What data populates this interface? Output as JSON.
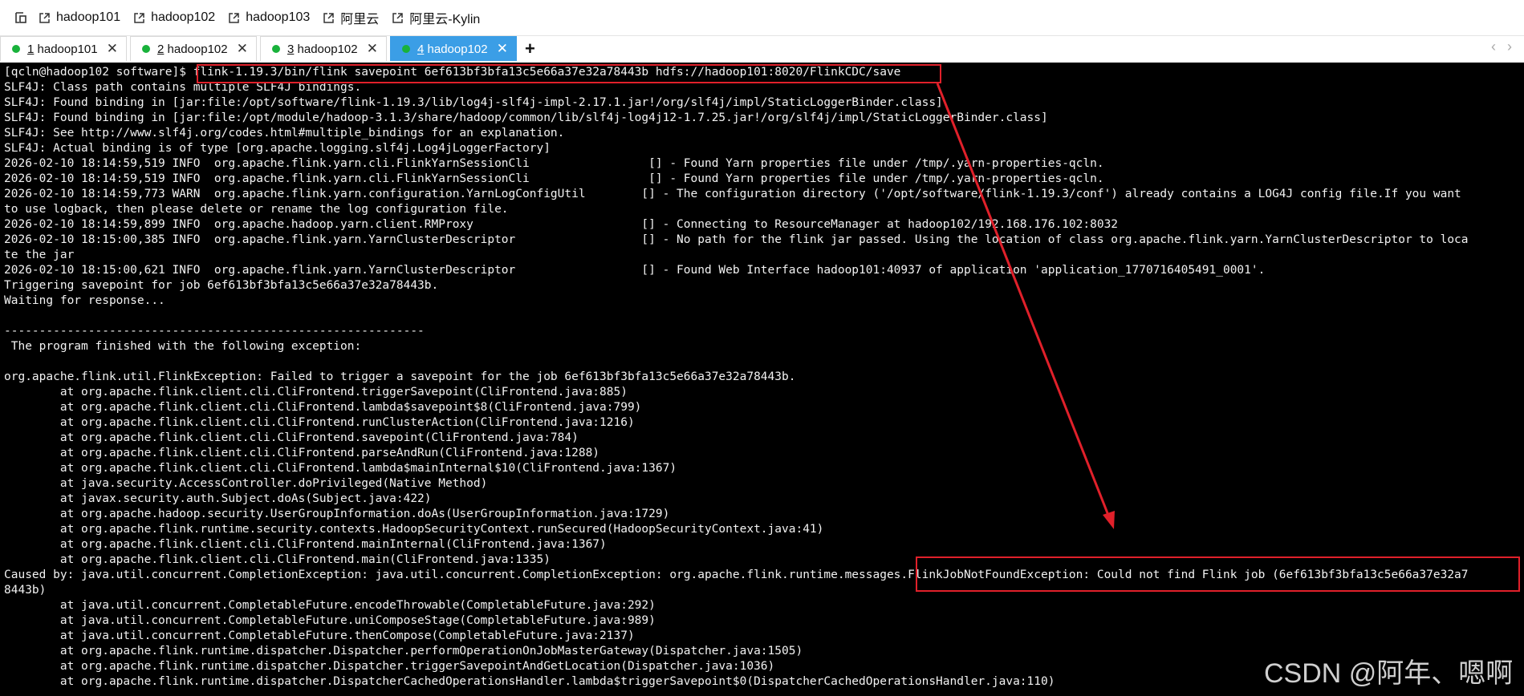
{
  "bookmarks": {
    "items": [
      "hadoop101",
      "hadoop102",
      "hadoop103",
      "阿里云",
      "阿里云-Kylin"
    ]
  },
  "tabs": [
    {
      "num": "1",
      "host": " hadoop101"
    },
    {
      "num": "2",
      "host": " hadoop102"
    },
    {
      "num": "3",
      "host": " hadoop102"
    },
    {
      "num": "4",
      "host": " hadoop102"
    }
  ],
  "terminal": {
    "lines": [
      "[qcln@hadoop102 software]$ flink-1.19.3/bin/flink savepoint 6ef613bf3bfa13c5e66a37e32a78443b hdfs://hadoop101:8020/FlinkCDC/save",
      "SLF4J: Class path contains multiple SLF4J bindings.",
      "SLF4J: Found binding in [jar:file:/opt/software/flink-1.19.3/lib/log4j-slf4j-impl-2.17.1.jar!/org/slf4j/impl/StaticLoggerBinder.class]",
      "SLF4J: Found binding in [jar:file:/opt/module/hadoop-3.1.3/share/hadoop/common/lib/slf4j-log4j12-1.7.25.jar!/org/slf4j/impl/StaticLoggerBinder.class]",
      "SLF4J: See http://www.slf4j.org/codes.html#multiple_bindings for an explanation.",
      "SLF4J: Actual binding is of type [org.apache.logging.slf4j.Log4jLoggerFactory]",
      "2026-02-10 18:14:59,519 INFO  org.apache.flink.yarn.cli.FlinkYarnSessionCli                 [] - Found Yarn properties file under /tmp/.yarn-properties-qcln.",
      "2026-02-10 18:14:59,519 INFO  org.apache.flink.yarn.cli.FlinkYarnSessionCli                 [] - Found Yarn properties file under /tmp/.yarn-properties-qcln.",
      "2026-02-10 18:14:59,773 WARN  org.apache.flink.yarn.configuration.YarnLogConfigUtil        [] - The configuration directory ('/opt/software/flink-1.19.3/conf') already contains a LOG4J config file.If you want",
      "to use logback, then please delete or rename the log configuration file.",
      "2026-02-10 18:14:59,899 INFO  org.apache.hadoop.yarn.client.RMProxy                        [] - Connecting to ResourceManager at hadoop102/192.168.176.102:8032",
      "2026-02-10 18:15:00,385 INFO  org.apache.flink.yarn.YarnClusterDescriptor                  [] - No path for the flink jar passed. Using the location of class org.apache.flink.yarn.YarnClusterDescriptor to loca",
      "te the jar",
      "2026-02-10 18:15:00,621 INFO  org.apache.flink.yarn.YarnClusterDescriptor                  [] - Found Web Interface hadoop101:40937 of application 'application_1770716405491_0001'.",
      "Triggering savepoint for job 6ef613bf3bfa13c5e66a37e32a78443b.",
      "Waiting for response...",
      "",
      "------------------------------------------------------------",
      " The program finished with the following exception:",
      "",
      "org.apache.flink.util.FlinkException: Failed to trigger a savepoint for the job 6ef613bf3bfa13c5e66a37e32a78443b.",
      "        at org.apache.flink.client.cli.CliFrontend.triggerSavepoint(CliFrontend.java:885)",
      "        at org.apache.flink.client.cli.CliFrontend.lambda$savepoint$8(CliFrontend.java:799)",
      "        at org.apache.flink.client.cli.CliFrontend.runClusterAction(CliFrontend.java:1216)",
      "        at org.apache.flink.client.cli.CliFrontend.savepoint(CliFrontend.java:784)",
      "        at org.apache.flink.client.cli.CliFrontend.parseAndRun(CliFrontend.java:1288)",
      "        at org.apache.flink.client.cli.CliFrontend.lambda$mainInternal$10(CliFrontend.java:1367)",
      "        at java.security.AccessController.doPrivileged(Native Method)",
      "        at javax.security.auth.Subject.doAs(Subject.java:422)",
      "        at org.apache.hadoop.security.UserGroupInformation.doAs(UserGroupInformation.java:1729)",
      "        at org.apache.flink.runtime.security.contexts.HadoopSecurityContext.runSecured(HadoopSecurityContext.java:41)",
      "        at org.apache.flink.client.cli.CliFrontend.mainInternal(CliFrontend.java:1367)",
      "        at org.apache.flink.client.cli.CliFrontend.main(CliFrontend.java:1335)",
      "Caused by: java.util.concurrent.CompletionException: java.util.concurrent.CompletionException: org.apache.flink.runtime.messages.FlinkJobNotFoundException: Could not find Flink job (6ef613bf3bfa13c5e66a37e32a7",
      "8443b)",
      "        at java.util.concurrent.CompletableFuture.encodeThrowable(CompletableFuture.java:292)",
      "        at java.util.concurrent.CompletableFuture.uniComposeStage(CompletableFuture.java:989)",
      "        at java.util.concurrent.CompletableFuture.thenCompose(CompletableFuture.java:2137)",
      "        at org.apache.flink.runtime.dispatcher.Dispatcher.performOperationOnJobMasterGateway(Dispatcher.java:1505)",
      "        at org.apache.flink.runtime.dispatcher.Dispatcher.triggerSavepointAndGetLocation(Dispatcher.java:1036)",
      "        at org.apache.flink.runtime.dispatcher.DispatcherCachedOperationsHandler.lambda$triggerSavepoint$0(DispatcherCachedOperationsHandler.java:110)"
    ]
  },
  "watermark": "CSDN @阿年、嗯啊",
  "colors": {
    "accent_tab": "#3b9ee6",
    "status_dot": "#19b23b",
    "highlight_box": "#e0202a"
  }
}
